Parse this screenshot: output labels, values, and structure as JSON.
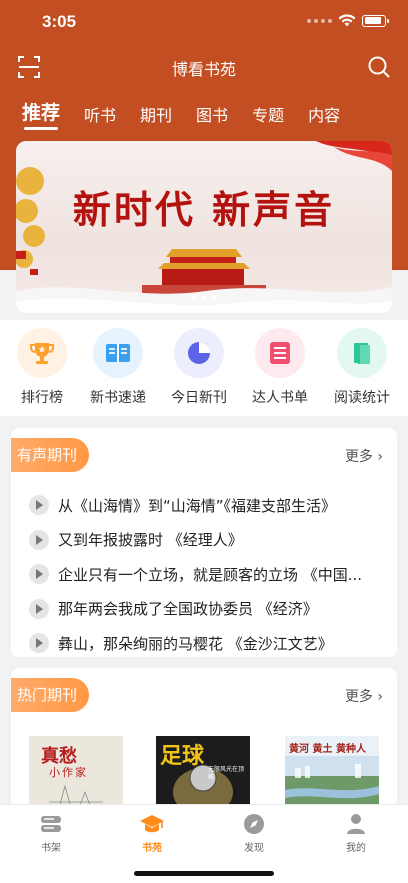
{
  "status_bar": {
    "time": "3:05",
    "battery_level": 0.85
  },
  "nav": {
    "title": "博看书苑",
    "scan_icon": "scan-icon",
    "search_icon": "search-icon"
  },
  "tabs": [
    {
      "label": "推荐",
      "active": true
    },
    {
      "label": "听书"
    },
    {
      "label": "期刊"
    },
    {
      "label": "图书"
    },
    {
      "label": "专题"
    },
    {
      "label": "内容"
    }
  ],
  "banner": {
    "title": "新时代 新声音"
  },
  "quick_links": [
    {
      "label": "排行榜",
      "icon": "trophy-icon",
      "color": "#ff9f2e"
    },
    {
      "label": "新书速递",
      "icon": "open-book-icon",
      "color": "#3aa0f0"
    },
    {
      "label": "今日新刊",
      "icon": "pie-chart-icon",
      "color": "#5b63e8"
    },
    {
      "label": "达人书单",
      "icon": "list-icon",
      "color": "#f0506e"
    },
    {
      "label": "阅读统计",
      "icon": "books-icon",
      "color": "#2fc39a"
    }
  ],
  "audio_section": {
    "title": "有声期刊",
    "more": "更多",
    "items": [
      "从《山海情》到“山海情”《福建支部生活》",
      "又到年报披露时 《经理人》",
      "企业只有一个立场，就是顾客的立场 《中国...",
      "那年两会我成了全国政协委员 《经济》",
      "彝山，那朵绚丽的马樱花 《金沙江文艺》"
    ]
  },
  "hot_section": {
    "title": "热门期刊",
    "more": "更多",
    "covers": [
      {
        "title": "真愁",
        "subtitle": "小作家"
      },
      {
        "title": "足球",
        "subtitle": "无限风光在顶峰"
      },
      {
        "title": "黄河 黄土 黄种人",
        "subtitle": ""
      }
    ]
  },
  "tabbar": [
    {
      "label": "书架",
      "icon": "bookshelf-icon"
    },
    {
      "label": "书苑",
      "icon": "graduation-cap-icon",
      "active": true
    },
    {
      "label": "发现",
      "icon": "compass-icon"
    },
    {
      "label": "我的",
      "icon": "user-icon"
    }
  ],
  "colors": {
    "brand": "#c24e22",
    "accent": "#ff9844",
    "active_tab": "#ff8c1a"
  }
}
